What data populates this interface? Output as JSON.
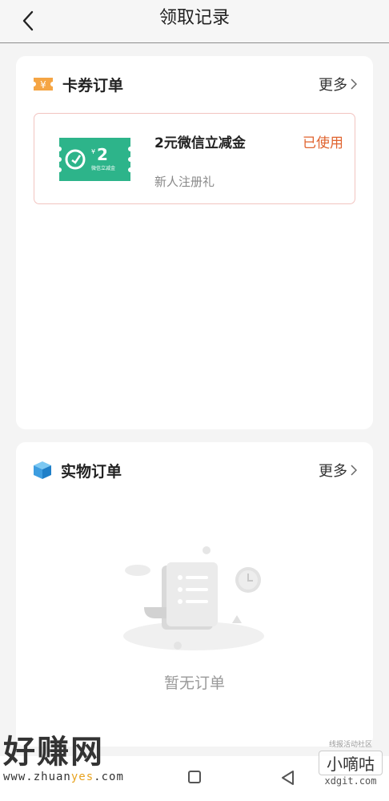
{
  "header": {
    "title": "领取记录"
  },
  "coupons_card": {
    "title": "卡券订单",
    "more_label": "更多",
    "items": [
      {
        "name": "2元微信立减金",
        "subtitle": "新人注册礼",
        "status": "已使用",
        "thumb_amount": "2",
        "thumb_currency": "¥",
        "thumb_caption": "微信立减金"
      }
    ]
  },
  "goods_card": {
    "title": "实物订单",
    "more_label": "更多",
    "empty_text": "暂无订单"
  },
  "watermarks": {
    "left_big": "好赚网",
    "left_url_a": "www.zhuan",
    "left_url_b": "yes",
    "left_url_c": ".com",
    "right_top": "线报活动社区",
    "right_mid": "小嘀咕",
    "right_bot": "xdgit.com"
  },
  "colors": {
    "accent": "#e0632e",
    "coupon_green": "#2db48a",
    "coupon_border": "#f2c4c0"
  }
}
